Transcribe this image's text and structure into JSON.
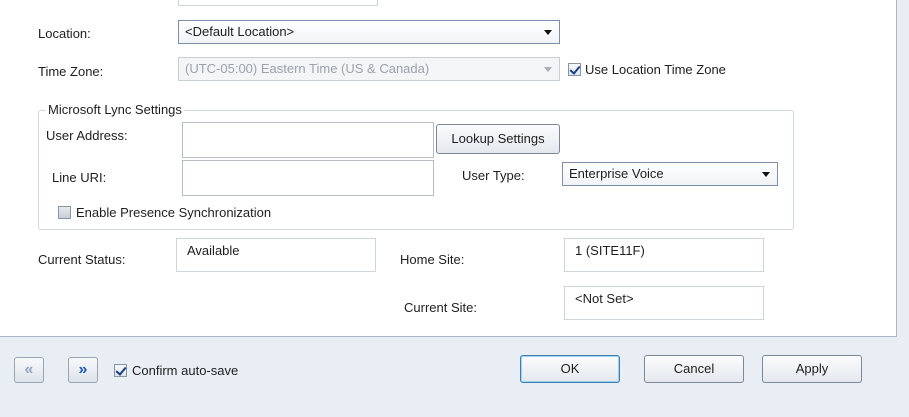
{
  "form": {
    "location": {
      "label": "Location:",
      "value": "<Default Location>"
    },
    "time_zone": {
      "label": "Time Zone:",
      "value": "(UTC-05:00) Eastern Time (US & Canada)",
      "use_location_label": "Use Location Time Zone",
      "use_location_checked": true
    },
    "lync": {
      "group_title": "Microsoft Lync Settings",
      "user_address_label": "User Address:",
      "user_address_value": "",
      "lookup_button": "Lookup Settings",
      "line_uri_label": "Line URI:",
      "line_uri_value": "",
      "user_type_label": "User Type:",
      "user_type_value": "Enterprise Voice",
      "presence_sync_label": "Enable Presence Synchronization",
      "presence_sync_checked": false
    },
    "current_status": {
      "label": "Current Status:",
      "value": "Available"
    },
    "home_site": {
      "label": "Home Site:",
      "value": "1 (SITE11F)"
    },
    "current_site": {
      "label": "Current Site:",
      "value": "<Not Set>"
    }
  },
  "footer": {
    "prev_icon": "double-chevron-left",
    "next_icon": "double-chevron-right",
    "prev_glyph": "«",
    "next_glyph": "»",
    "confirm_autosave_label": "Confirm auto-save",
    "confirm_autosave_checked": true,
    "ok_label": "OK",
    "cancel_label": "Cancel",
    "apply_label": "Apply"
  },
  "colors": {
    "nav_prev": "#8fa3bd",
    "nav_next": "#1e5bb8",
    "panel_bg": "#ffffff",
    "footer_bg": "#e9eef5"
  }
}
